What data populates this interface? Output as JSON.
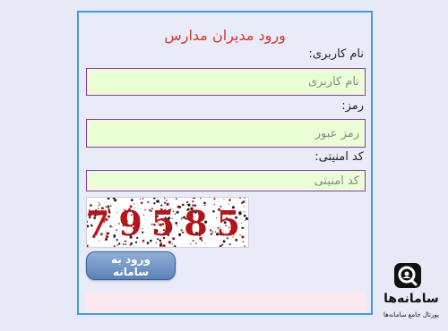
{
  "form": {
    "title": "ورود مدیران مدارس",
    "username_label": "نام کاربری:",
    "username_placeholder": "نام کاربری",
    "password_label": "رمز:",
    "password_placeholder": "رمز عبور",
    "security_label": "کد امنیتی:",
    "security_placeholder": "کد امنیتی",
    "captcha_text": "79585",
    "submit_label": "ورود به سامانه"
  },
  "logo": {
    "name": "سامانه‌ها",
    "subtitle": "پورتال جامع سامانه‌ها"
  },
  "colors": {
    "title": "#d43a2a",
    "field_bg": "#eaffd6",
    "field_border": "#8a3aa8",
    "panel_border": "#3aa0d8",
    "captcha_digits": "#b3151b"
  }
}
